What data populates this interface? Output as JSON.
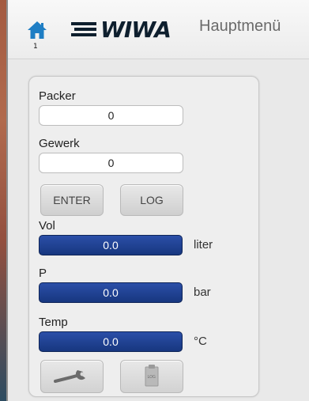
{
  "header": {
    "home_page_number": "1",
    "brand": "WIWA",
    "title": "Hauptmenü"
  },
  "form": {
    "packer": {
      "label": "Packer",
      "value": "0"
    },
    "gewerk": {
      "label": "Gewerk",
      "value": "0"
    }
  },
  "buttons": {
    "enter": "ENTER",
    "log": "LOG",
    "log_icon_caption": "LOG"
  },
  "readings": {
    "vol": {
      "label": "Vol",
      "value": "0.0",
      "unit": "liter"
    },
    "p": {
      "label": "P",
      "value": "0.0",
      "unit": "bar"
    },
    "temp": {
      "label": "Temp",
      "value": "0.0",
      "unit": "°C"
    }
  },
  "icons": {
    "home": "home-icon",
    "settings": "wrench-icon",
    "log_file": "log-document-icon"
  },
  "colors": {
    "accent": "#1f7ec4",
    "meter_fill": "#1e3f92",
    "brand_dark": "#0e1f2e"
  }
}
